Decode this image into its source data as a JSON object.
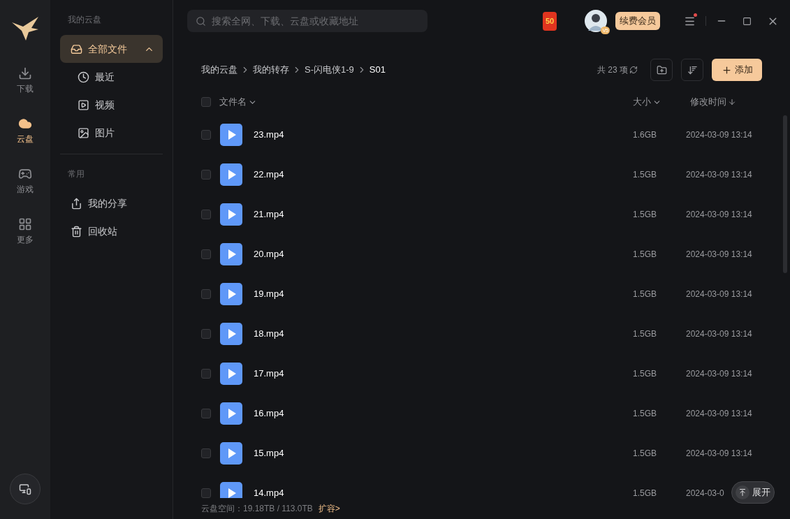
{
  "rail": {
    "items": [
      {
        "label": "下载",
        "kind": "download",
        "selected": false
      },
      {
        "label": "云盘",
        "kind": "cloud",
        "selected": true
      },
      {
        "label": "游戏",
        "kind": "game",
        "selected": false
      },
      {
        "label": "更多",
        "kind": "more",
        "selected": false
      }
    ]
  },
  "sidebar": {
    "sections": [
      {
        "title": "我的云盘",
        "items": [
          {
            "label": "全部文件",
            "kind": "inbox",
            "selected": true,
            "expanded": true,
            "children": [
              {
                "label": "最近",
                "kind": "clock",
                "selected": false
              },
              {
                "label": "视频",
                "kind": "video",
                "selected": false
              },
              {
                "label": "图片",
                "kind": "image",
                "selected": false
              }
            ]
          }
        ]
      },
      {
        "title": "常用",
        "items": [
          {
            "label": "我的分享",
            "kind": "share",
            "selected": false
          },
          {
            "label": "回收站",
            "kind": "trash",
            "selected": false
          }
        ]
      }
    ]
  },
  "search": {
    "placeholder": "搜索全网、下载、云盘或收藏地址"
  },
  "red_packet": "50",
  "avatar_badge": "V5",
  "vip_button": "续费会员",
  "menu_has_notification": true,
  "breadcrumb": [
    "我的云盘",
    "我的转存",
    "S-闪电侠1-9",
    "S01"
  ],
  "item_count": "共 23 项",
  "add_button": "添加",
  "table": {
    "select_all_checked": false,
    "columns": [
      "文件名",
      "大小",
      "修改时间"
    ],
    "rows": [
      {
        "name": "23.mp4",
        "size": "1.6GB",
        "modified": "2024-03-09 13:14",
        "checked": false
      },
      {
        "name": "22.mp4",
        "size": "1.5GB",
        "modified": "2024-03-09 13:14",
        "checked": false
      },
      {
        "name": "21.mp4",
        "size": "1.5GB",
        "modified": "2024-03-09 13:14",
        "checked": false
      },
      {
        "name": "20.mp4",
        "size": "1.5GB",
        "modified": "2024-03-09 13:14",
        "checked": false
      },
      {
        "name": "19.mp4",
        "size": "1.5GB",
        "modified": "2024-03-09 13:14",
        "checked": false
      },
      {
        "name": "18.mp4",
        "size": "1.5GB",
        "modified": "2024-03-09 13:14",
        "checked": false
      },
      {
        "name": "17.mp4",
        "size": "1.5GB",
        "modified": "2024-03-09 13:14",
        "checked": false
      },
      {
        "name": "16.mp4",
        "size": "1.5GB",
        "modified": "2024-03-09 13:14",
        "checked": false
      },
      {
        "name": "15.mp4",
        "size": "1.5GB",
        "modified": "2024-03-09 13:14",
        "checked": false
      },
      {
        "name": "14.mp4",
        "size": "1.5GB",
        "modified": "2024-03-0",
        "checked": false
      }
    ]
  },
  "storage": {
    "text": "云盘空间：19.18TB / 113.0TB",
    "link": "扩容>"
  },
  "expand_button": "展开"
}
